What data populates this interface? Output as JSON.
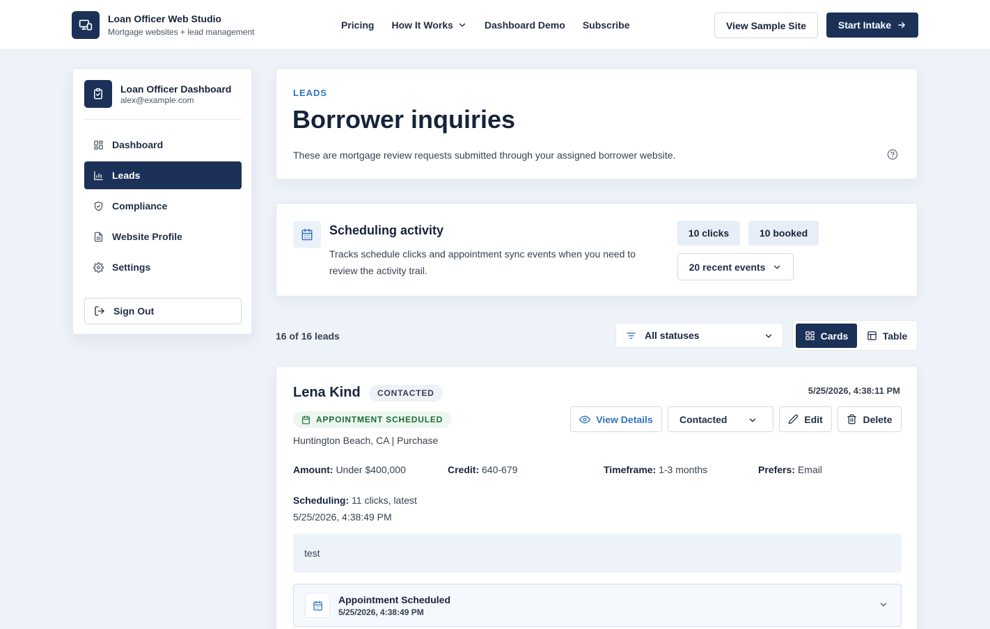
{
  "brand": {
    "title": "Loan Officer Web Studio",
    "subtitle": "Mortgage websites + lead management",
    "logo_icon": "monitor-phone-icon"
  },
  "nav": {
    "pricing": "Pricing",
    "how_it_works": "How It Works",
    "dashboard_demo": "Dashboard Demo",
    "subscribe": "Subscribe",
    "view_sample_site": "View Sample Site",
    "start_intake": "Start Intake"
  },
  "sidebar": {
    "title": "Loan Officer Dashboard",
    "email": "alex@example.com",
    "items": [
      {
        "label": "Dashboard",
        "icon": "grid-icon",
        "active": false
      },
      {
        "label": "Leads",
        "icon": "bar-chart-icon",
        "active": true
      },
      {
        "label": "Compliance",
        "icon": "shield-icon",
        "active": false
      },
      {
        "label": "Website Profile",
        "icon": "document-icon",
        "active": false
      },
      {
        "label": "Settings",
        "icon": "gear-icon",
        "active": false
      }
    ],
    "sign_out": "Sign Out"
  },
  "header": {
    "eyebrow": "LEADS",
    "title": "Borrower inquiries",
    "description": "These are mortgage review requests submitted through your assigned borrower website."
  },
  "scheduling": {
    "title": "Scheduling activity",
    "description": "Tracks schedule clicks and appointment sync events when you need to review the activity trail.",
    "clicks": "10 clicks",
    "booked": "10 booked",
    "recent_events": "20 recent events"
  },
  "toolbar": {
    "count": "16 of 16 leads",
    "status_filter": "All statuses",
    "view_cards": "Cards",
    "view_table": "Table",
    "active_view": "Cards"
  },
  "lead": {
    "name": "Lena Kind",
    "status_badge": "CONTACTED",
    "date": "5/25/2026, 4:38:11 PM",
    "appointment_badge": "APPOINTMENT SCHEDULED",
    "location": "Huntington Beach, CA | Purchase",
    "actions": {
      "view_details": "View Details",
      "status_value": "Contacted",
      "edit": "Edit",
      "delete": "Delete"
    },
    "fields": {
      "amount_label": "Amount:",
      "amount_value": "Under $400,000",
      "credit_label": "Credit:",
      "credit_value": "640-679",
      "timeframe_label": "Timeframe:",
      "timeframe_value": "1-3 months",
      "prefers_label": "Prefers:",
      "prefers_value": "Email",
      "scheduling_label": "Scheduling:",
      "scheduling_value": "11 clicks, latest 5/25/2026, 4:38:49 PM"
    },
    "notes": "test",
    "event": {
      "title": "Appointment Scheduled",
      "time": "5/25/2026, 4:38:49 PM"
    }
  },
  "colors": {
    "primary": "#1b3158",
    "accent": "#2f73c0",
    "background": "#eef3f9",
    "success_text": "#1d6b36",
    "success_bg": "#edf7ef"
  }
}
